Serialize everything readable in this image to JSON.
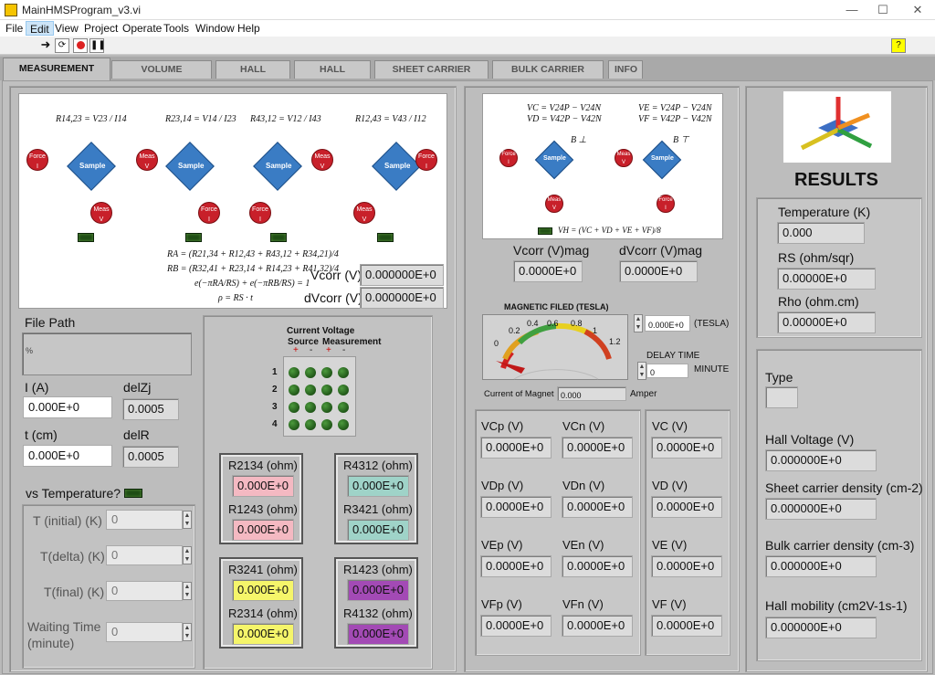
{
  "window": {
    "title": "MainHMSProgram_v3.vi",
    "min": "—",
    "max": "☐",
    "close": "✕"
  },
  "menu": [
    "File",
    "Edit",
    "View",
    "Project",
    "Operate",
    "Tools",
    "Window",
    "Help"
  ],
  "tabs": [
    "MEASUREMENT DATA",
    "VOLUME RESISTIVITY",
    "HALL VOLTAGE",
    "HALL MOBILITY",
    "SHEET CARRIER DENSITY",
    "BULK CARRIER DENSITY",
    "INFO"
  ],
  "diagram1": {
    "formulas": [
      "R14,23 = V23 / I14",
      "R23,14 = V14 / I23",
      "R43,12 = V12 / I43",
      "R12,43 = V43 / I12"
    ],
    "ra": "RA = (R21,34 + R12,43 + R43,12 + R34,21)/4",
    "rb": "RB = (R32,41 + R23,14 + R14,23 + R41,32)/4",
    "vdp": "e(−πRA/RS) + e(−πRB/RS) = 1",
    "rho": "ρ = RS · t",
    "force": "Force",
    "meas": "Meas",
    "sample": "Sample",
    "i": "I",
    "v": "V"
  },
  "vcorr": {
    "label": "Vcorr (V)",
    "value": "0.000000E+0"
  },
  "dvcorr": {
    "label": "dVcorr (V)",
    "value": "0.000000E+0"
  },
  "filepath": {
    "label": "File Path",
    "glyph": "%"
  },
  "current": {
    "label": "I (A)",
    "value": "0.000E+0"
  },
  "delzj": {
    "label": "delZj",
    "value": "0.0005"
  },
  "thickness": {
    "label": "t (cm)",
    "value": "0.000E+0"
  },
  "delr": {
    "label": "delR",
    "value": "0.0005"
  },
  "vstemp": {
    "label": "vs Temperature?"
  },
  "temp": {
    "initial_label": "T (initial) (K)",
    "initial": "0",
    "delta_label": "T(delta) (K)",
    "delta": "0",
    "final_label": "T(final) (K)",
    "final": "0",
    "wait_label1": "Waiting Time",
    "wait_label2": "(minute)",
    "wait": "0"
  },
  "matrix": {
    "title1": "Current Voltage",
    "title2a": "Source",
    "title2b": "Measurement",
    "signs": [
      "+",
      "-",
      "+",
      "-"
    ],
    "rows": [
      "1",
      "2",
      "3",
      "4"
    ]
  },
  "resistances": [
    {
      "l1": "R2134 (ohm)",
      "v1": "0.000E+0",
      "l2": "R1243 (ohm)",
      "v2": "0.000E+0",
      "color": "#f4b9c2"
    },
    {
      "l1": "R4312 (ohm)",
      "v1": "0.000E+0",
      "l2": "R3421 (ohm)",
      "v2": "0.000E+0",
      "color": "#9fd3c8"
    },
    {
      "l1": "R3241 (ohm)",
      "v1": "0.000E+0",
      "l2": "R2314 (ohm)",
      "v2": "0.000E+0",
      "color": "#f5f56a"
    },
    {
      "l1": "R1423 (ohm)",
      "v1": "0.000E+0",
      "l2": "R4132 (ohm)",
      "v2": "0.000E+0",
      "color": "#a34ab5"
    }
  ],
  "diagram2": {
    "f1": "VC = V24P − V24N",
    "f2": "VD = V42P − V42N",
    "f3": "VE = V24P − V24N",
    "f4": "VF = V42P − V42N",
    "b1": "B ⊥",
    "b2": "B ⊤",
    "vh": "VH = (VC + VD + VE + VF)/8"
  },
  "vcorr_mag": {
    "label": "Vcorr (V)mag",
    "value": "0.0000E+0"
  },
  "dvcorr_mag": {
    "label": "dVcorr (V)mag",
    "value": "0.0000E+0"
  },
  "magnet": {
    "title": "MAGNETIC FILED (TESLA)",
    "ticks": [
      "0",
      "0.2",
      "0.4",
      "0.6",
      "0.8",
      "1",
      "1.2"
    ],
    "level": 0,
    "setpoint": "0.000E+0",
    "unit": "(TESLA)",
    "delay_label": "DELAY TIME",
    "delay": "0",
    "delay_unit": "MINUTE",
    "current_label": "Current of Magnet",
    "current": "0.000",
    "current_unit": "Amper"
  },
  "voltages": [
    {
      "l": "VCp (V)",
      "v": "0.0000E+0"
    },
    {
      "l": "VCn (V)",
      "v": "0.0000E+0"
    },
    {
      "l": "VC (V)",
      "v": "0.0000E+0"
    },
    {
      "l": "VDp (V)",
      "v": "0.0000E+0"
    },
    {
      "l": "VDn (V)",
      "v": "0.0000E+0"
    },
    {
      "l": "VD (V)",
      "v": "0.0000E+0"
    },
    {
      "l": "VEp (V)",
      "v": "0.0000E+0"
    },
    {
      "l": "VEn (V)",
      "v": "0.0000E+0"
    },
    {
      "l": "VE (V)",
      "v": "0.0000E+0"
    },
    {
      "l": "VFp (V)",
      "v": "0.0000E+0"
    },
    {
      "l": "VFn (V)",
      "v": "0.0000E+0"
    },
    {
      "l": "VF (V)",
      "v": "0.0000E+0"
    }
  ],
  "results": {
    "title": "RESULTS",
    "temp_label": "Temperature (K)",
    "temp": "0.000",
    "rs_label": "RS (ohm/sqr)",
    "rs": "0.00000E+0",
    "rho_label": "Rho (ohm.cm)",
    "rho": "0.00000E+0",
    "type_label": "Type",
    "type": "",
    "hall_label": "Hall Voltage (V)",
    "hall": "0.000000E+0",
    "sheet_label": "Sheet carrier density (cm-2)",
    "sheet": "0.000000E+0",
    "bulk_label": "Bulk carrier density (cm-3)",
    "bulk": "0.000000E+0",
    "mob_label": "Hall mobility (cm2V-1s-1)",
    "mob": "0.000000E+0"
  }
}
